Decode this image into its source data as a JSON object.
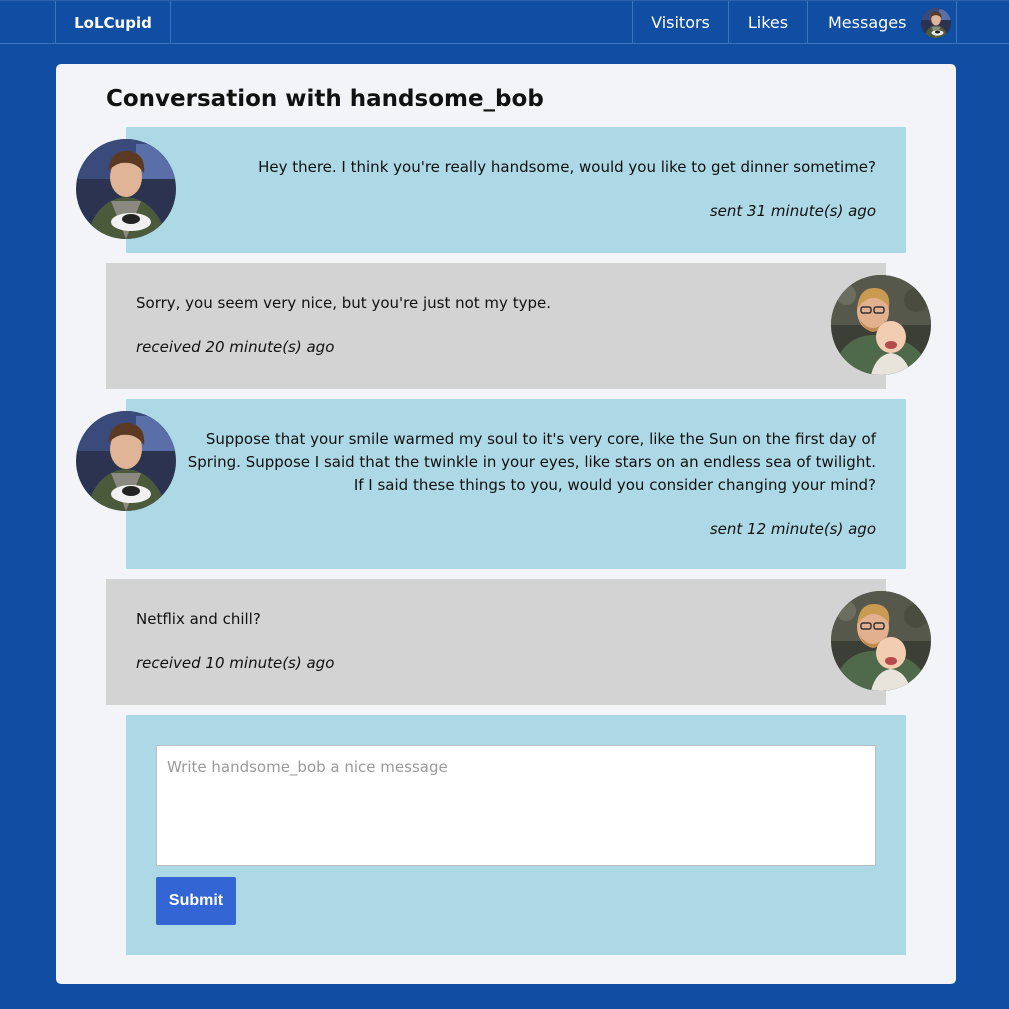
{
  "nav": {
    "brand": "LoLCupid",
    "visitors": "Visitors",
    "likes": "Likes",
    "messages": "Messages"
  },
  "page": {
    "title": "Conversation with handsome_bob"
  },
  "messages": [
    {
      "direction": "sent",
      "text": "Hey there. I think you're really handsome, would you like to get dinner sometime?",
      "stamp": "sent 31 minute(s) ago"
    },
    {
      "direction": "received",
      "text": "Sorry, you seem very nice, but you're just not my type.",
      "stamp": "received 20 minute(s) ago"
    },
    {
      "direction": "sent",
      "text": "Suppose that your smile warmed my soul to it's very core, like the Sun on the first day of Spring. Suppose I said that the twinkle in your eyes, like stars on an endless sea of twilight. If I said these things to you, would you consider changing your mind?",
      "stamp": "sent 12 minute(s) ago"
    },
    {
      "direction": "received",
      "text": "Netflix and chill?",
      "stamp": "received 10 minute(s) ago"
    }
  ],
  "compose": {
    "placeholder": "Write handsome_bob a nice message",
    "submit_label": "Submit"
  },
  "colors": {
    "background": "#0f4ea3",
    "sent_bubble": "#add8e6",
    "received_bubble": "#d3d3d3",
    "submit_button": "#3465d4"
  }
}
